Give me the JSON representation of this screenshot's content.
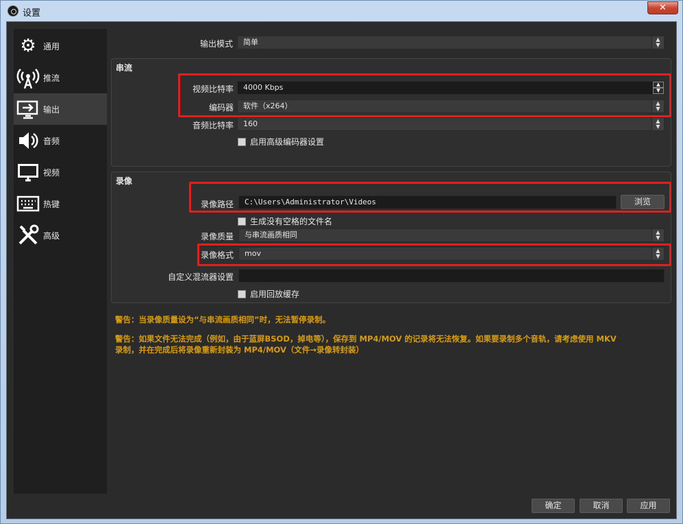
{
  "window": {
    "title": "设置",
    "close_glyph": "✕"
  },
  "sidebar": {
    "items": [
      {
        "label": "通用",
        "icon": "gear-icon"
      },
      {
        "label": "推流",
        "icon": "broadcast-icon"
      },
      {
        "label": "输出",
        "icon": "output-icon"
      },
      {
        "label": "音频",
        "icon": "speaker-icon"
      },
      {
        "label": "视频",
        "icon": "monitor-icon"
      },
      {
        "label": "热键",
        "icon": "keyboard-icon"
      },
      {
        "label": "高级",
        "icon": "tools-icon"
      }
    ],
    "active_index": 2
  },
  "output_mode": {
    "label": "输出模式",
    "value": "简单"
  },
  "streaming": {
    "title": "串流",
    "video_bitrate": {
      "label": "视频比特率",
      "value": "4000 Kbps"
    },
    "encoder": {
      "label": "编码器",
      "value": "软件（x264）"
    },
    "audio_bitrate": {
      "label": "音频比特率",
      "value": "160"
    },
    "advanced_encoder": {
      "label": "启用高级编码器设置",
      "checked": false
    }
  },
  "recording": {
    "title": "录像",
    "path": {
      "label": "录像路径",
      "value": "C:\\Users\\Administrator\\Videos",
      "browse_label": "浏览"
    },
    "no_space_filename": {
      "label": "生成没有空格的文件名",
      "checked": false
    },
    "quality": {
      "label": "录像质量",
      "value": "与串流画质相同"
    },
    "format": {
      "label": "录像格式",
      "value": "mov"
    },
    "muxer": {
      "label": "自定义混流器设置",
      "value": ""
    },
    "replay_buffer": {
      "label": "启用回放缓存",
      "checked": false
    }
  },
  "warnings": {
    "w1": "警告：当录像质量设为“与串流画质相同”时，无法暂停录制。",
    "w2_line1": "警告：如果文件无法完成（例如，由于蓝屏BSOD，掉电等），保存到 MP4/MOV 的记录将无法恢复。如果要录制多个音轨，请考虑使用 MKV",
    "w2_line2": "录制，并在完成后将录像重新封装为 MP4/MOV（文件→录像转封装）"
  },
  "footer": {
    "ok_label": "确定",
    "cancel_label": "取消",
    "apply_label": "应用"
  },
  "colors": {
    "highlight_box": "#e0201e",
    "warning_text": "#d89c10",
    "background": "#2b2b2b"
  }
}
